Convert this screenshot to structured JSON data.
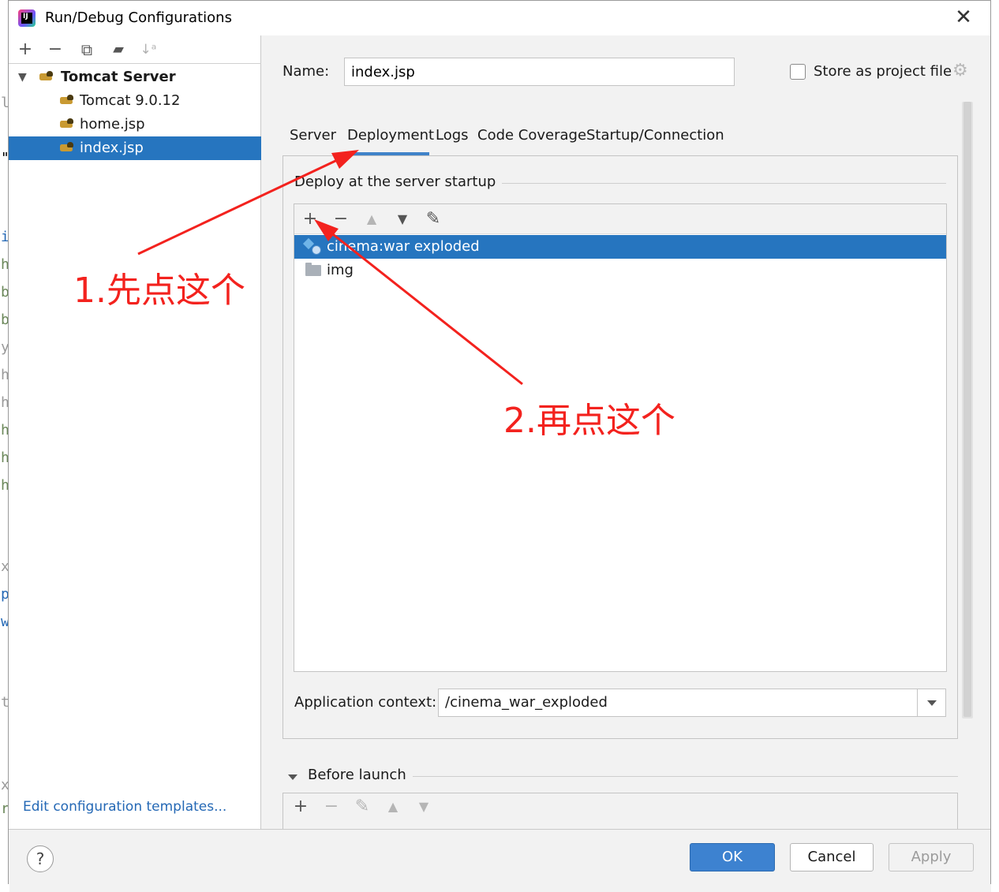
{
  "window": {
    "title": "Run/Debug Configurations",
    "close_glyph": "✕"
  },
  "left_toolbar": {
    "add": "+",
    "remove": "−",
    "copy": "⧉",
    "folder": "▰",
    "sort": "↓ᵃ"
  },
  "tree": {
    "group_label": "Tomcat Server",
    "items": [
      {
        "label": "Tomcat 9.0.12",
        "selected": false
      },
      {
        "label": "home.jsp",
        "selected": false
      },
      {
        "label": "index.jsp",
        "selected": true
      }
    ]
  },
  "edit_templates_link": "Edit configuration templates...",
  "name_field": {
    "label": "Name:",
    "value": "index.jsp"
  },
  "store_as_project_file": {
    "label": "Store as project file",
    "checked": false
  },
  "tabs": [
    {
      "label": "Server",
      "active": false
    },
    {
      "label": "Deployment",
      "active": true
    },
    {
      "label": "Logs",
      "active": false
    },
    {
      "label": "Code Coverage",
      "active": false
    },
    {
      "label": "Startup/Connection",
      "active": false
    }
  ],
  "deploy_section": {
    "title": "Deploy at the server startup",
    "toolbar": {
      "add": "+",
      "remove": "−",
      "up": "▲",
      "down": "▼",
      "edit": "✎"
    },
    "items": [
      {
        "label": "cinema:war exploded",
        "icon": "artifact-icon",
        "selected": true
      },
      {
        "label": "img",
        "icon": "folder-icon",
        "selected": false
      }
    ]
  },
  "application_context": {
    "label": "Application context:",
    "value": "/cinema_war_exploded"
  },
  "before_launch": {
    "label": "Before launch",
    "toolbar": {
      "add": "+",
      "remove": "−",
      "edit": "✎",
      "up": "▲",
      "down": "▼"
    }
  },
  "footer": {
    "help": "?",
    "ok": "OK",
    "cancel": "Cancel",
    "apply": "Apply"
  },
  "annotations": {
    "step1": "1.先点这个",
    "step2": "2.再点这个",
    "color": "#f3221e"
  },
  "colors": {
    "selection": "#2675bf",
    "accent": "#3d82d0",
    "link": "#2468b5"
  }
}
